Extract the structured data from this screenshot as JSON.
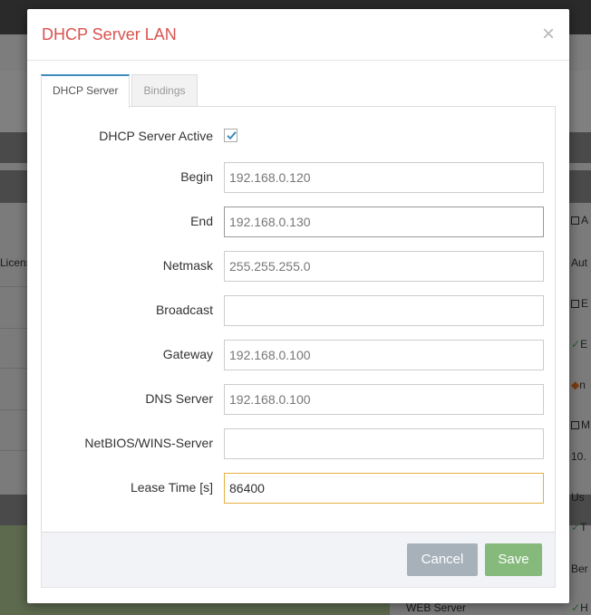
{
  "background": {
    "left_text": "Licens",
    "right_items": [
      {
        "type": "checkbox",
        "text": "A"
      },
      {
        "type": "text",
        "text": "Aut"
      },
      {
        "type": "checkbox",
        "text": "E"
      },
      {
        "type": "check-ok",
        "text": "E"
      },
      {
        "type": "shield",
        "text": "n"
      },
      {
        "type": "checkbox",
        "text": "M"
      },
      {
        "type": "text",
        "text": "10."
      },
      {
        "type": "text",
        "text": "Us"
      },
      {
        "type": "check-ok",
        "text": "T"
      },
      {
        "type": "text",
        "text": "Ber"
      },
      {
        "type": "check-ok",
        "text": "H"
      }
    ],
    "web_server_label": "WEB Server"
  },
  "modal": {
    "title": "DHCP Server LAN",
    "close_symbol": "×",
    "tabs": [
      {
        "label": "DHCP Server",
        "active": true
      },
      {
        "label": "Bindings",
        "active": false
      }
    ],
    "form": {
      "active_label": "DHCP Server Active",
      "active_checked": true,
      "fields": [
        {
          "label": "Begin",
          "value": "192.168.0.120"
        },
        {
          "label": "End",
          "value": "192.168.0.130"
        },
        {
          "label": "Netmask",
          "value": "255.255.255.0"
        },
        {
          "label": "Broadcast",
          "value": ""
        },
        {
          "label": "Gateway",
          "value": "192.168.0.100"
        },
        {
          "label": "DNS Server",
          "value": "192.168.0.100"
        },
        {
          "label": "NetBIOS/WINS-Server",
          "value": ""
        },
        {
          "label": "Lease Time [s]",
          "value": "86400"
        }
      ]
    },
    "buttons": {
      "cancel": "Cancel",
      "save": "Save"
    },
    "colors": {
      "title": "#d9534f",
      "tab_accent": "#3c8dbc",
      "checkbox_check": "#3c8dbc",
      "cancel_bg": "#a6b1ba",
      "save_bg": "#86b97c",
      "focus_border": "#e3b13f"
    }
  }
}
